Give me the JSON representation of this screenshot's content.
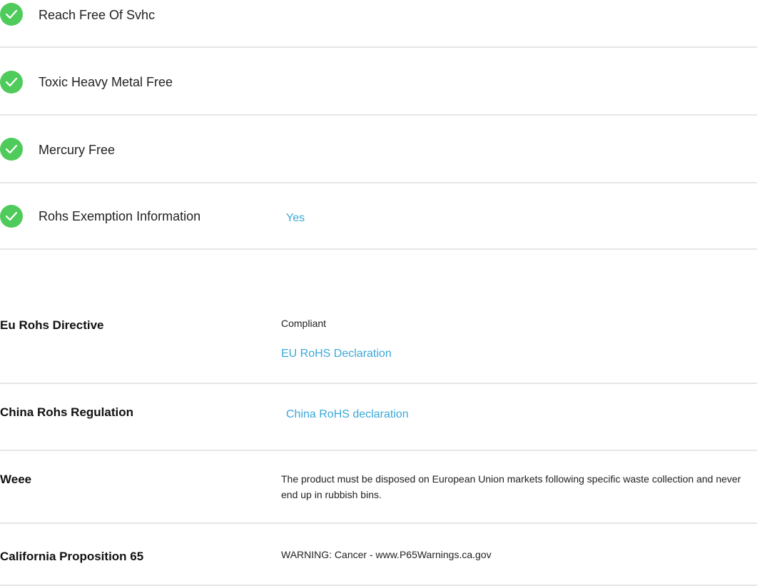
{
  "features": [
    {
      "label": "Reach Free Of Svhc",
      "value": ""
    },
    {
      "label": "Toxic Heavy Metal Free",
      "value": ""
    },
    {
      "label": "Mercury Free",
      "value": ""
    },
    {
      "label": "Rohs Exemption Information",
      "value": "Yes"
    }
  ],
  "regulations": {
    "eu_rohs": {
      "label": "Eu Rohs Directive",
      "status": "Compliant",
      "link": "EU RoHS Declaration"
    },
    "china_rohs": {
      "label": "China Rohs Regulation",
      "link": "China RoHS declaration"
    },
    "weee": {
      "label": "Weee",
      "text": "The product must be disposed on European Union markets following specific waste collection and never end up in rubbish bins."
    },
    "prop65": {
      "label": "California Proposition 65",
      "text": "WARNING: Cancer - www.P65Warnings.ca.gov"
    }
  },
  "colors": {
    "check": "#4fcb5b",
    "link": "#3aa8d8",
    "divider": "#e6e6e6"
  }
}
